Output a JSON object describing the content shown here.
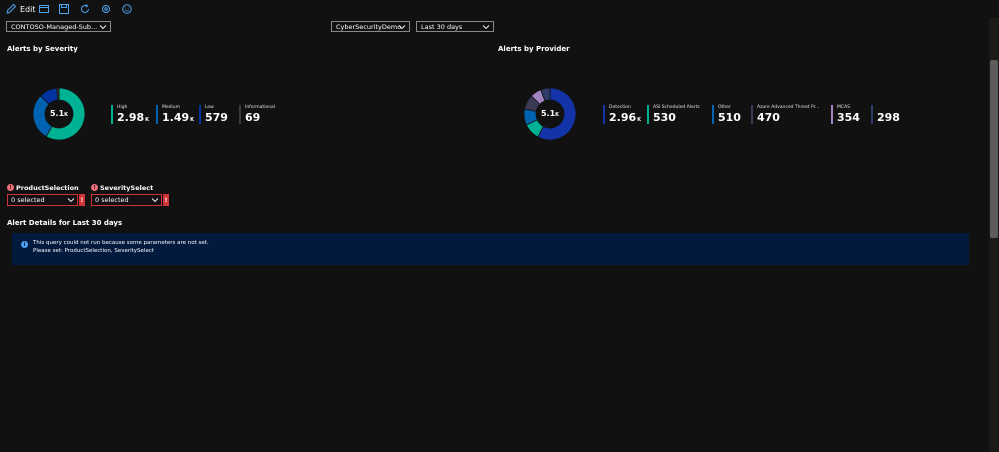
{
  "toolbar": {
    "edit_label": "Edit",
    "icons": [
      "edit-icon",
      "open-icon",
      "save-icon",
      "refresh-icon",
      "settings-icon",
      "feedback-icon"
    ]
  },
  "params": {
    "subscription": "CONTOSO-Managed-Sub...",
    "workspace": "CyberSecurityDemo",
    "time_range": "Last 30 days"
  },
  "severity": {
    "title": "Alerts by Severity",
    "total": "5.1",
    "total_unit": "K",
    "legend": [
      {
        "label": "High",
        "value": "2.98",
        "unit": "K",
        "color": "#00b294"
      },
      {
        "label": "Medium",
        "value": "1.49",
        "unit": "K",
        "color": "#0063b1"
      },
      {
        "label": "Low",
        "value": "579",
        "unit": "",
        "color": "#0032a0"
      },
      {
        "label": "Informational",
        "value": "69",
        "unit": "",
        "color": "#3b3a39"
      }
    ],
    "chart_data": {
      "type": "pie",
      "categories": [
        "High",
        "Medium",
        "Low",
        "Informational"
      ],
      "values": [
        2980,
        1490,
        579,
        69
      ],
      "colors": [
        "#00b294",
        "#0063b1",
        "#0032a0",
        "#3b3a39"
      ]
    }
  },
  "provider": {
    "title": "Alerts by Provider",
    "total": "5.1",
    "total_unit": "K",
    "legend": [
      {
        "label": "Detection",
        "value": "2.96",
        "unit": "K",
        "color": "#1234a8"
      },
      {
        "label": "ASI Scheduled Alerts",
        "value": "530",
        "unit": "",
        "color": "#00b294"
      },
      {
        "label": "Other",
        "value": "510",
        "unit": "",
        "color": "#0063b1"
      },
      {
        "label": "Azure Advanced Threat Pr...",
        "value": "470",
        "unit": "",
        "color": "#3b3a55"
      },
      {
        "label": "MCAS",
        "value": "354",
        "unit": "",
        "color": "#a285c0"
      },
      {
        "label": "",
        "value": "298",
        "unit": "",
        "color": "#2e3b66"
      }
    ],
    "chart_data": {
      "type": "pie",
      "categories": [
        "Detection",
        "ASI Scheduled Alerts",
        "Other",
        "Azure Advanced Threat Pr...",
        "MCAS",
        ""
      ],
      "values": [
        2960,
        530,
        510,
        470,
        354,
        298
      ],
      "colors": [
        "#1234a8",
        "#00b294",
        "#0063b1",
        "#3b3a55",
        "#a285c0",
        "#2e3b66"
      ]
    }
  },
  "product_selection": {
    "label": "ProductSelection",
    "value": "0 selected",
    "error_mark": "!"
  },
  "severity_select": {
    "label": "SeveritySelect",
    "value": "0 selected",
    "error_mark": "!"
  },
  "details": {
    "title": "Alert Details for Last 30 days",
    "message_line1": "This query could not run because some parameters are not set.",
    "message_line2": "Please set: ProductSelection, SeveritySelect"
  }
}
